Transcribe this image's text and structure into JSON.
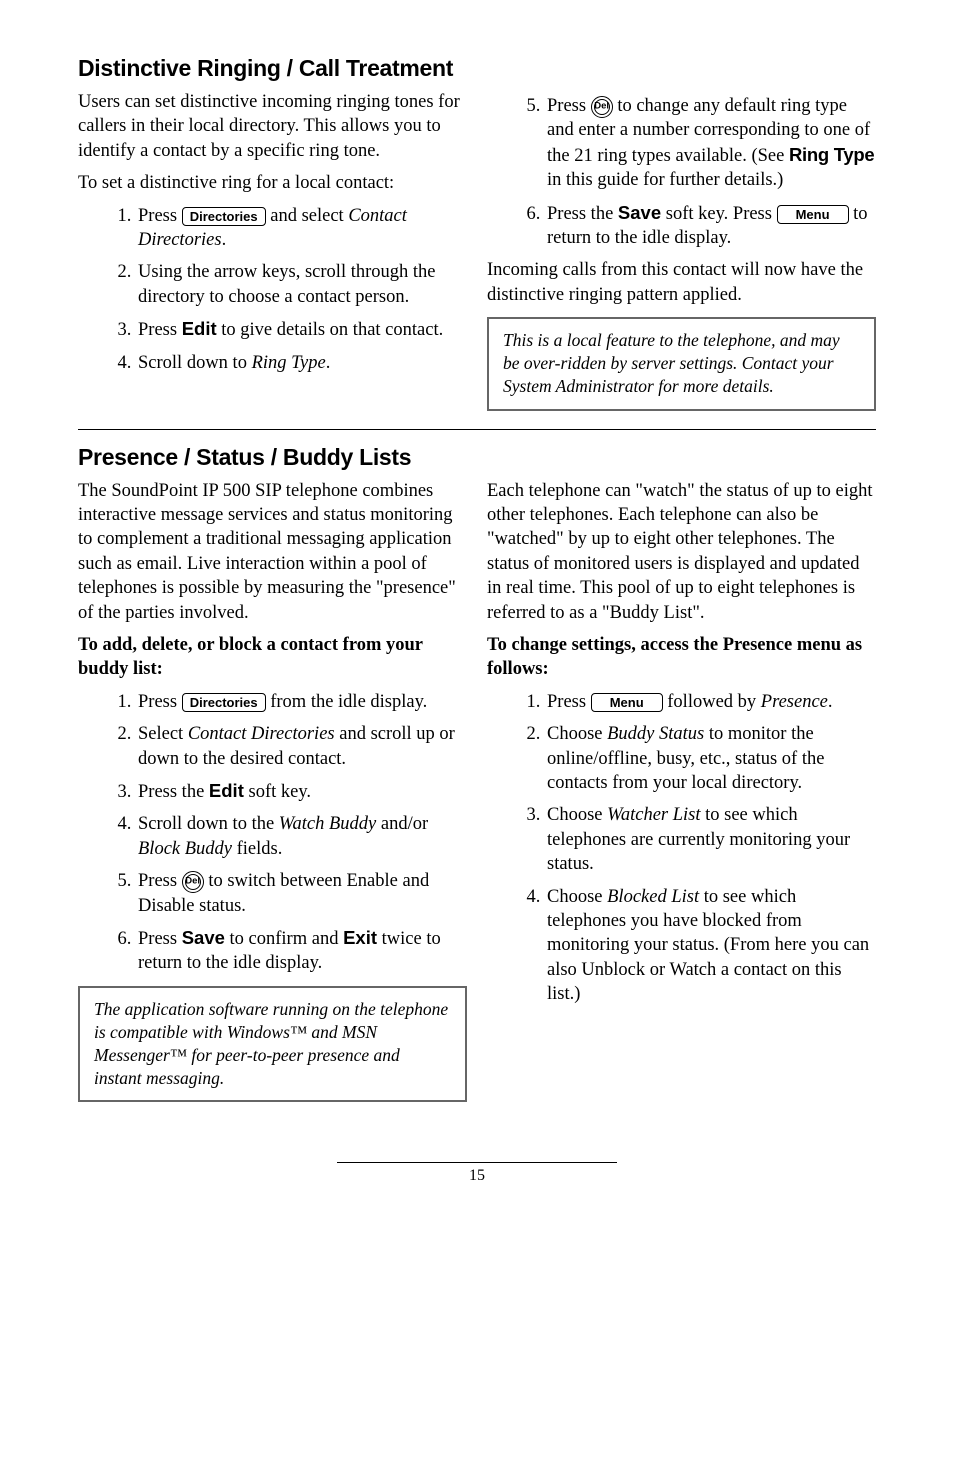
{
  "section1": {
    "title": "Distinctive Ringing / Call Treatment",
    "left": {
      "p1": "Users can set distinctive incoming ringing tones for callers in their local directory. This allows you to identify a contact by a specific ring tone.",
      "p2": "To set a distinctive ring for a local contact:",
      "s1a": "Press ",
      "s1btn": "Directories",
      "s1b": " and select ",
      "s1c": "Contact Directories",
      "s1d": ".",
      "s2": "Using the arrow keys, scroll through the directory to choose a contact person.",
      "s3a": "Press ",
      "s3key": "Edit",
      "s3b": " to give details on that contact.",
      "s4a": "Scroll down to ",
      "s4b": "Ring Type",
      "s4c": "."
    },
    "right": {
      "s5a": "Press ",
      "s5b": " to change any default ring type and enter a number corresponding to one of the 21 ring types available.  (See ",
      "s5c": "Ring Type",
      "s5d": " in this guide for further details.)",
      "s6a": "Press the ",
      "s6key": "Save",
      "s6b": " soft key.  Press ",
      "s6btn": "Menu",
      "s6c": " to return to the idle display.",
      "p3": "Incoming calls from this contact will now have the distinctive ringing pattern applied.",
      "note": "This is a local feature to the telephone, and may be over-ridden by server settings. Contact your System Administrator for more details."
    }
  },
  "section2": {
    "title": "Presence / Status / Buddy Lists",
    "left": {
      "p1": "The SoundPoint IP 500 SIP telephone combines interactive message services and status monitoring to complement a traditional messaging application such as email. Live interaction within a pool of telephones is possible by measuring the \"presence\" of the parties involved.",
      "subhead": "To add, delete, or block a contact from your buddy list:",
      "s1a": "Press ",
      "s1btn": "Directories",
      "s1b": " from the idle display.",
      "s2a": "Select ",
      "s2b": "Contact Directories",
      "s2c": " and scroll up or down to the desired contact.",
      "s3a": "Press the ",
      "s3key": "Edit",
      "s3b": " soft key.",
      "s4a": "Scroll down to the ",
      "s4b": "Watch Buddy",
      "s4c": " and/or ",
      "s4d": "Block Buddy",
      "s4e": " fields.",
      "s5a": "Press ",
      "s5b": " to switch between Enable and Disable status.",
      "s6a": "Press ",
      "s6key1": "Save",
      "s6b": " to confirm and ",
      "s6key2": "Exit",
      "s6c": " twice to return to the idle display.",
      "note": "The application software running on the telephone is compatible with Windows™ and MSN Messenger™ for peer-to-peer presence and instant messaging."
    },
    "right": {
      "p1": "Each telephone can \"watch\" the status of up to eight other telephones.  Each telephone can also be \"watched\" by up to eight other telephones.  The status of monitored users is displayed and updated in real time.  This pool of up to eight telephones is referred to as a \"Buddy List\".",
      "subhead": "To change settings, access the Presence menu as follows:",
      "s1a": "Press ",
      "s1btn": "Menu",
      "s1b": " followed by ",
      "s1c": "Presence",
      "s1d": ".",
      "s2a": "Choose ",
      "s2b": "Buddy Status",
      "s2c": " to monitor the online/offline, busy, etc., status of the contacts from your local directory.",
      "s3a": "Choose ",
      "s3b": "Watcher List",
      "s3c": " to see which telephones are currently monitoring your status.",
      "s4a": "Choose ",
      "s4b": "Blocked List",
      "s4c": " to see which telephones you have blocked from monitoring your status.  (From here you can also Unblock or Watch a contact on this list.)"
    }
  },
  "footer": {
    "page": "15"
  }
}
